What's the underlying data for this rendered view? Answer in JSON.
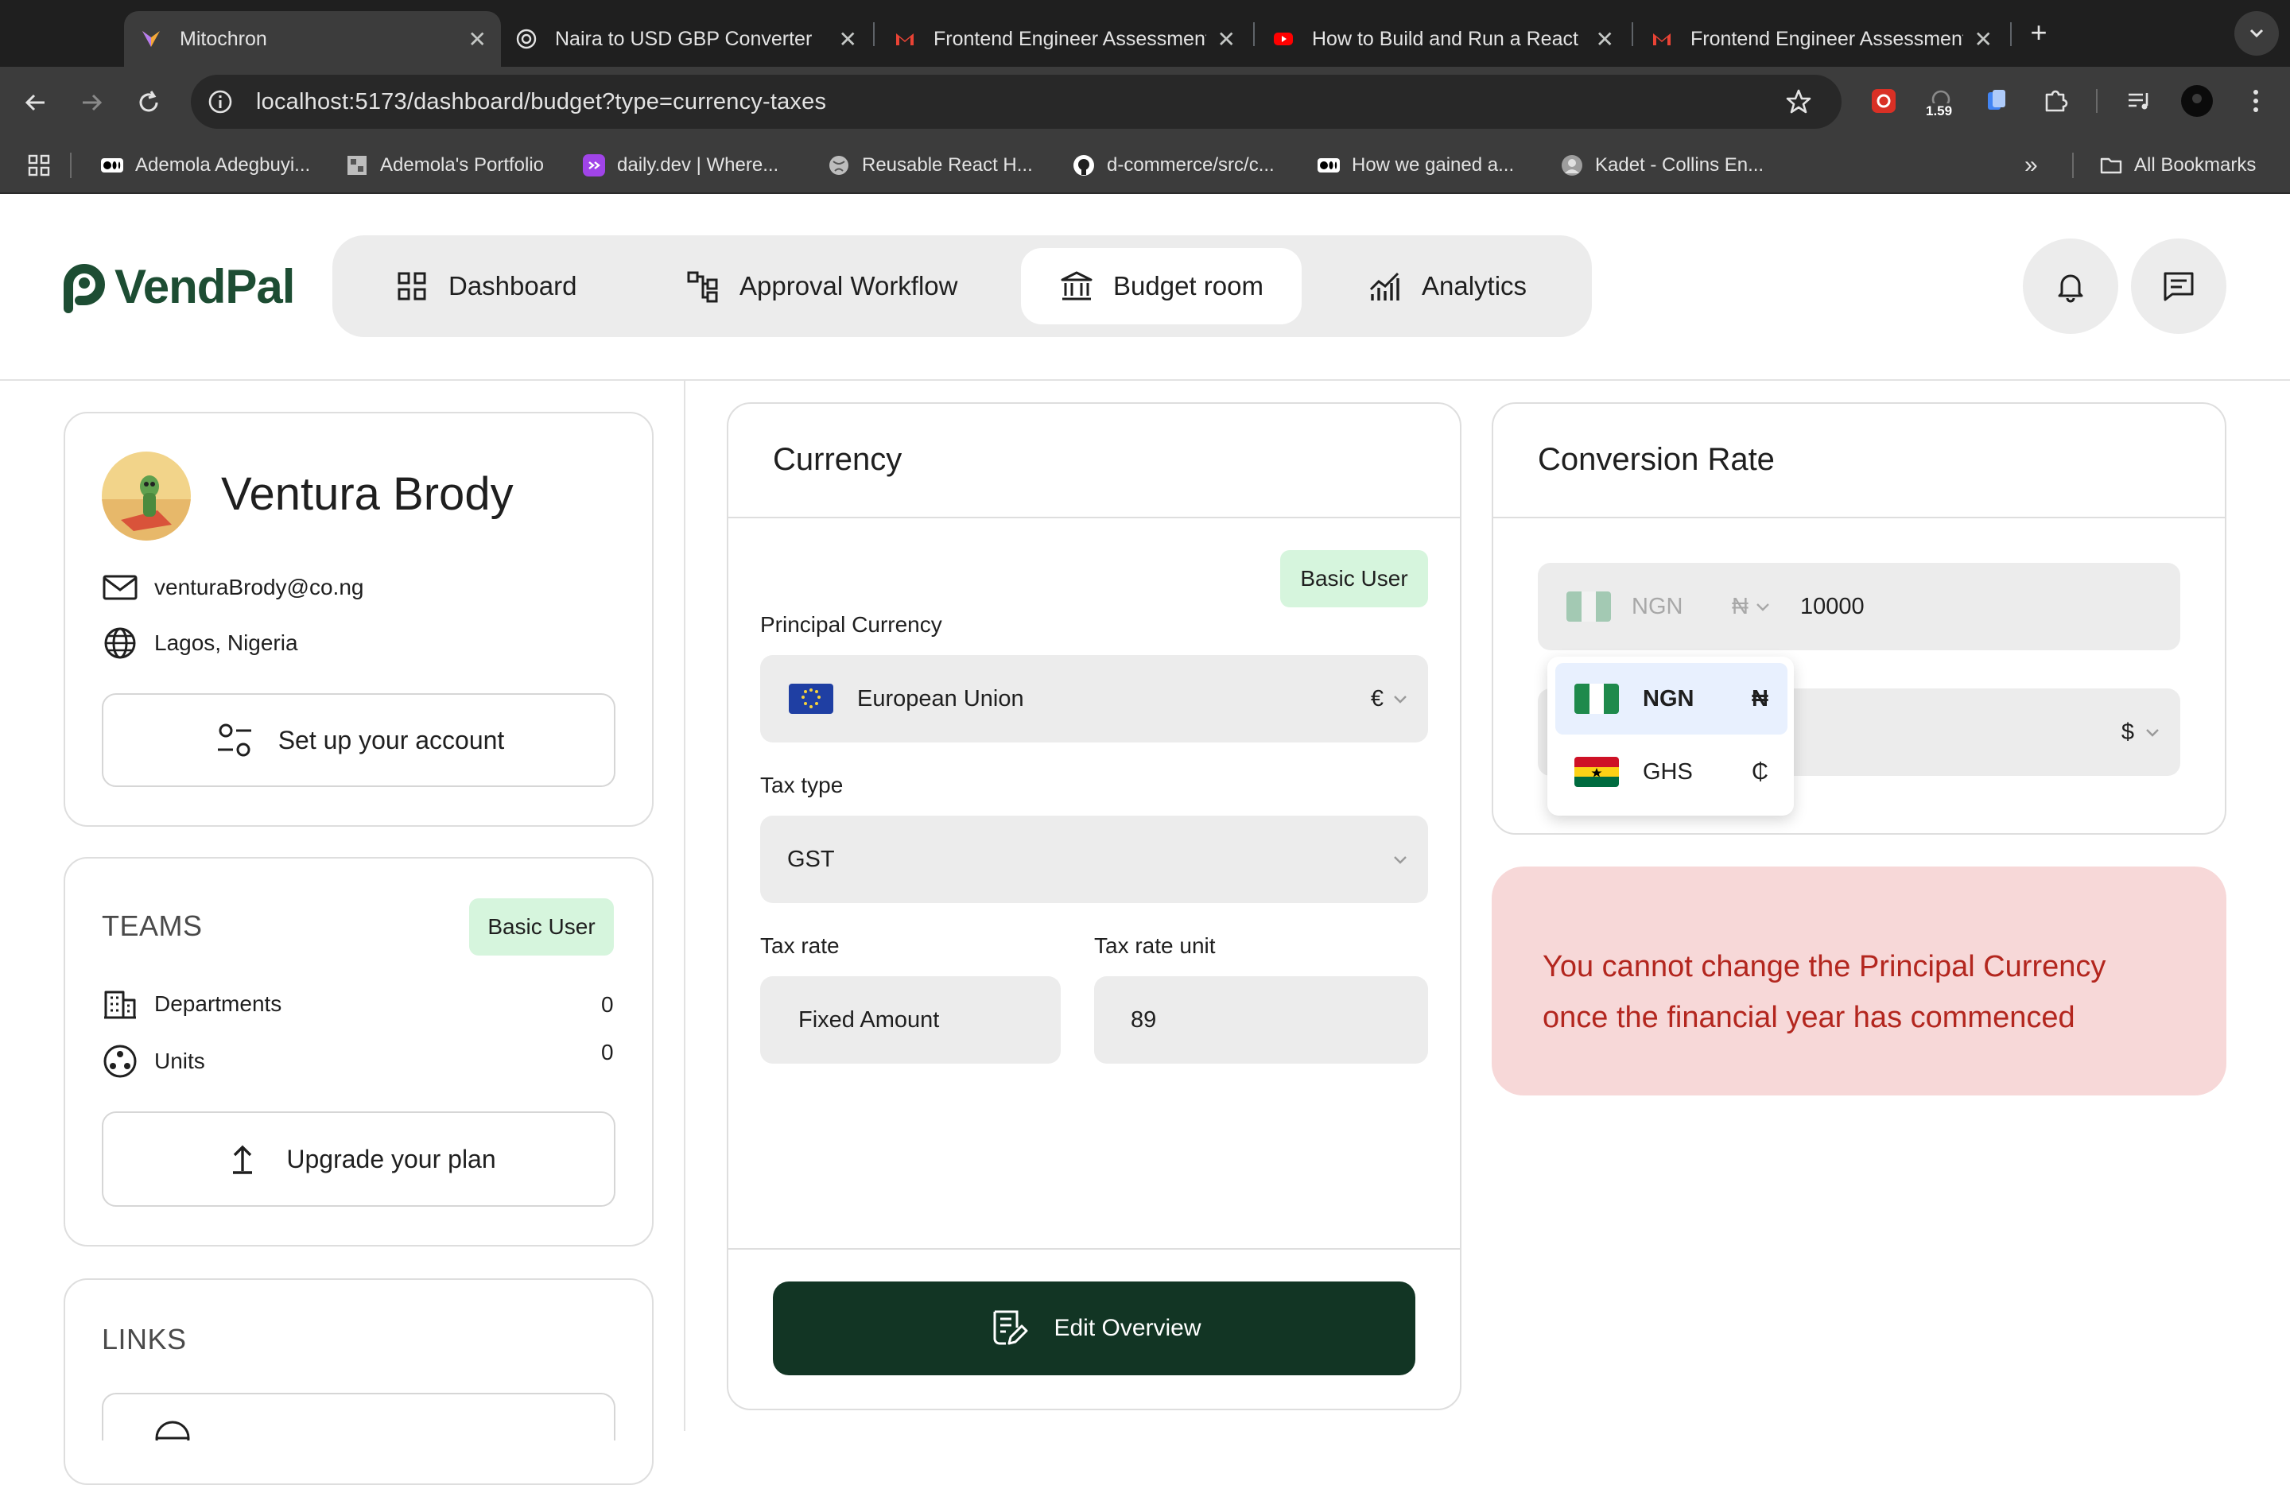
{
  "browser": {
    "tabs": [
      {
        "title": "Mitochron",
        "icon": "mitochron-icon",
        "active": true
      },
      {
        "title": "Naira to USD GBP Converter",
        "icon": "chatgpt-icon"
      },
      {
        "title": "Frontend Engineer Assessment",
        "icon": "gmail-icon"
      },
      {
        "title": "How to Build and Run a React",
        "icon": "youtube-icon"
      },
      {
        "title": "Frontend Engineer Assessment",
        "icon": "gmail-icon"
      }
    ],
    "url": "localhost:5173/dashboard/budget?type=currency-taxes",
    "extension_badge": "1.59",
    "bookmarks": [
      {
        "label": "Ademola Adegbuyi...",
        "icon": "medium-icon"
      },
      {
        "label": "Ademola's Portfolio",
        "icon": "portfolio-icon"
      },
      {
        "label": "daily.dev | Where...",
        "icon": "dailydev-icon"
      },
      {
        "label": "Reusable React H...",
        "icon": "globe-icon"
      },
      {
        "label": "d-commerce/src/c...",
        "icon": "github-icon"
      },
      {
        "label": "How we gained a...",
        "icon": "medium-icon"
      },
      {
        "label": "Kadet - Collins En...",
        "icon": "profile-icon"
      }
    ],
    "all_bookmarks": "All Bookmarks"
  },
  "app": {
    "logo": "VendPal",
    "nav": [
      {
        "label": "Dashboard",
        "icon": "grid-icon"
      },
      {
        "label": "Approval Workflow",
        "icon": "workflow-icon"
      },
      {
        "label": "Budget room",
        "icon": "bank-icon",
        "active": true
      },
      {
        "label": "Analytics",
        "icon": "chart-icon"
      }
    ]
  },
  "profile": {
    "name": "Ventura Brody",
    "email": "venturaBrody@co.ng",
    "location": "Lagos, Nigeria",
    "setup_button": "Set up your account"
  },
  "teams": {
    "heading": "TEAMS",
    "badge": "Basic User",
    "rows": [
      {
        "label": "Departments",
        "count": "0"
      },
      {
        "label": "Units",
        "count": "0"
      }
    ],
    "upgrade_button": "Upgrade your plan"
  },
  "links": {
    "heading": "LINKS"
  },
  "currency": {
    "title": "Currency",
    "badge": "Basic User",
    "principal_label": "Principal Currency",
    "principal_value": "European Union",
    "principal_symbol": "€",
    "tax_type_label": "Tax type",
    "tax_type_value": "GST",
    "tax_rate_label": "Tax rate",
    "tax_rate_value": "Fixed Amount",
    "tax_rate_unit_label": "Tax rate unit",
    "tax_rate_unit_value": "89",
    "edit_button": "Edit Overview"
  },
  "conversion": {
    "title": "Conversion Rate",
    "from_currency": "NGN",
    "from_symbol": "₦",
    "amount": "10000",
    "to_symbol": "$",
    "dropdown": [
      {
        "code": "NGN",
        "symbol": "₦",
        "selected": true
      },
      {
        "code": "GHS",
        "symbol": "₵"
      }
    ]
  },
  "alert": "You cannot change the Principal Currency once the financial year has commenced",
  "colors": {
    "brand": "#1d4d33",
    "button": "#123524",
    "badge": "#d6f5dd",
    "alert_bg": "#f7d8d8",
    "alert_text": "#b3261e"
  }
}
